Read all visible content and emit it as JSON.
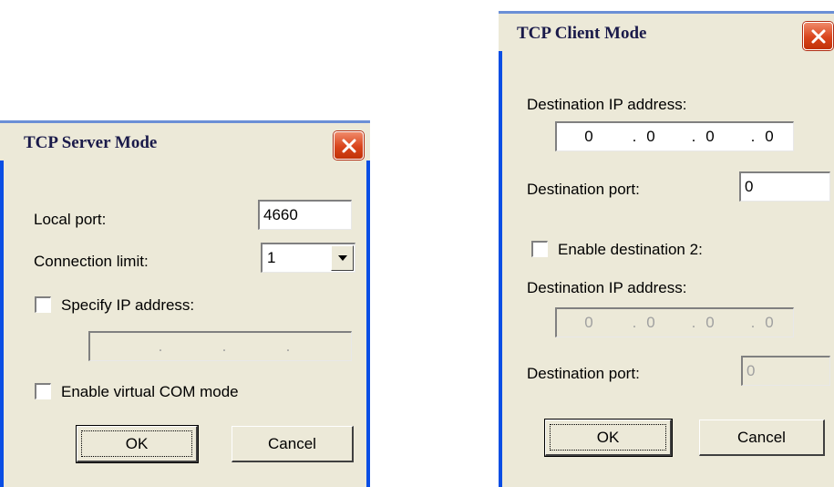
{
  "server_dialog": {
    "title": "TCP Server Mode",
    "local_port_label": "Local port:",
    "local_port_value": "4660",
    "connection_limit_label": "Connection limit:",
    "connection_limit_value": "1",
    "specify_ip_label": "Specify IP address:",
    "specify_ip_checked": false,
    "specify_ip_octets": [
      "",
      "",
      "",
      ""
    ],
    "virtual_com_label": "Enable virtual COM mode",
    "virtual_com_checked": false,
    "ok_label": "OK",
    "cancel_label": "Cancel"
  },
  "client_dialog": {
    "title": "TCP Client Mode",
    "dest_ip_label": "Destination IP address:",
    "dest_ip_octets": [
      "0",
      "0",
      "0",
      "0"
    ],
    "dest_port_label": "Destination port:",
    "dest_port_value": "0",
    "enable_dest2_label": "Enable destination 2:",
    "enable_dest2_checked": false,
    "dest2_ip_label": "Destination IP address:",
    "dest2_ip_octets": [
      "0",
      "0",
      "0",
      "0"
    ],
    "dest2_port_label": "Destination port:",
    "dest2_port_value": "0",
    "ok_label": "OK",
    "cancel_label": "Cancel"
  },
  "colors": {
    "dialog_background": "#ece9d8",
    "frame_blue": "#0a4ee4",
    "close_button_red": "#d9441c",
    "disabled_text": "#a0a0a0"
  },
  "icons": {
    "close": "close-icon",
    "dropdown": "chevron-down-icon"
  }
}
